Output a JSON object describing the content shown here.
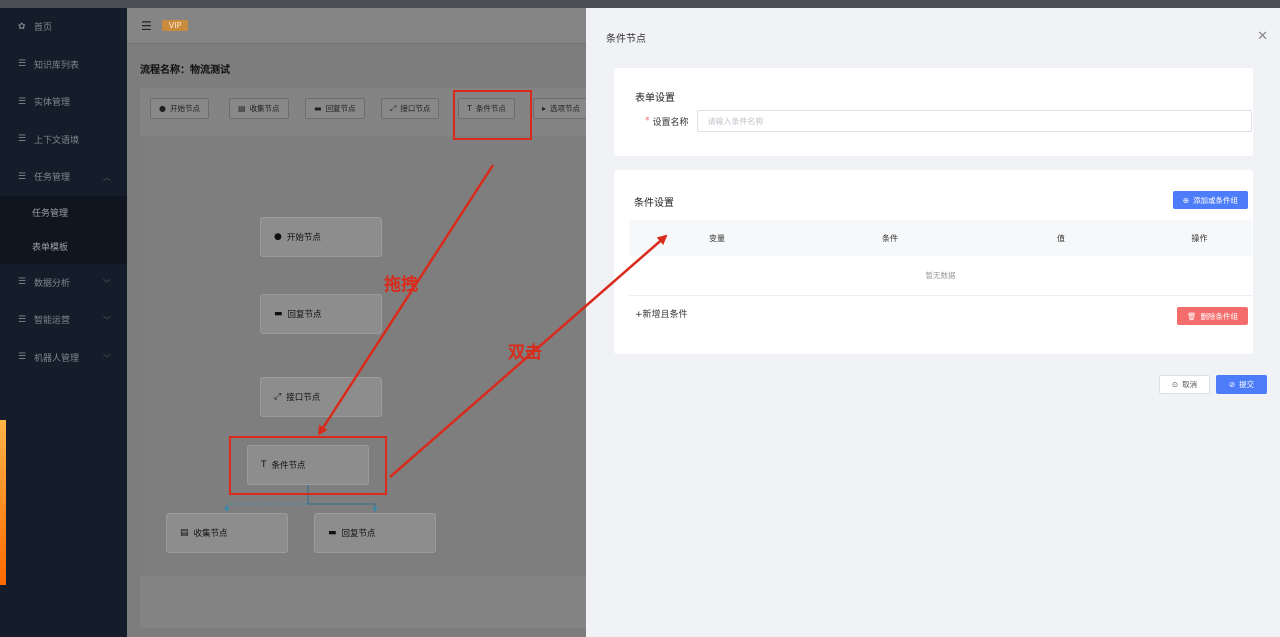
{
  "sidebar": {
    "items": [
      {
        "icon": "dashboard-icon",
        "label": "首页"
      },
      {
        "icon": "list-icon",
        "label": "知识库列表"
      },
      {
        "icon": "list-icon",
        "label": "实体管理"
      },
      {
        "icon": "list-icon",
        "label": "上下文语境"
      },
      {
        "icon": "list-icon",
        "label": "任务管理",
        "expanded": true
      }
    ],
    "sub_items": [
      {
        "label": "任务管理"
      },
      {
        "label": "表单模板"
      }
    ],
    "items_after": [
      {
        "icon": "list-icon",
        "label": "数据分析"
      },
      {
        "icon": "list-icon",
        "label": "智能运营"
      },
      {
        "icon": "list-icon",
        "label": "机器人管理"
      }
    ]
  },
  "header": {
    "badge": "VIP"
  },
  "flow": {
    "title": "流程名称：物流测试"
  },
  "toolbar": {
    "buttons": [
      {
        "icon": "play-circle-icon",
        "label": "开始节点"
      },
      {
        "icon": "form-icon",
        "label": "收集节点"
      },
      {
        "icon": "message-icon",
        "label": "回复节点"
      },
      {
        "icon": "api-icon",
        "label": "接口节点"
      },
      {
        "icon": "filter-icon",
        "label": "条件节点"
      },
      {
        "icon": "option-icon",
        "label": "选项节点"
      }
    ]
  },
  "canvas": {
    "nodes": [
      {
        "icon": "play-circle-icon",
        "label": "开始节点"
      },
      {
        "icon": "message-icon",
        "label": "回复节点"
      },
      {
        "icon": "api-icon",
        "label": "接口节点"
      },
      {
        "icon": "filter-icon",
        "label": "条件节点"
      },
      {
        "icon": "form-icon",
        "label": "收集节点"
      },
      {
        "icon": "message-icon",
        "label": "回复节点"
      }
    ]
  },
  "drawer": {
    "title": "条件节点",
    "form_section": {
      "title": "表单设置",
      "name_label": "设置名称",
      "name_value": "",
      "name_placeholder": "请输入条件名称"
    },
    "condition_section": {
      "title": "条件设置",
      "add_or_label": "添加或条件组",
      "columns": [
        "变量",
        "条件",
        "值",
        "操作"
      ],
      "empty_text": "暂无数据",
      "add_and_label": "+新增且条件",
      "delete_group_label": "删除条件组"
    },
    "cancel_label": "取消",
    "submit_label": "提交"
  },
  "annotations": {
    "drag_label": "拖拽",
    "dblclick_label": "双击",
    "color": "#d92b1b"
  }
}
